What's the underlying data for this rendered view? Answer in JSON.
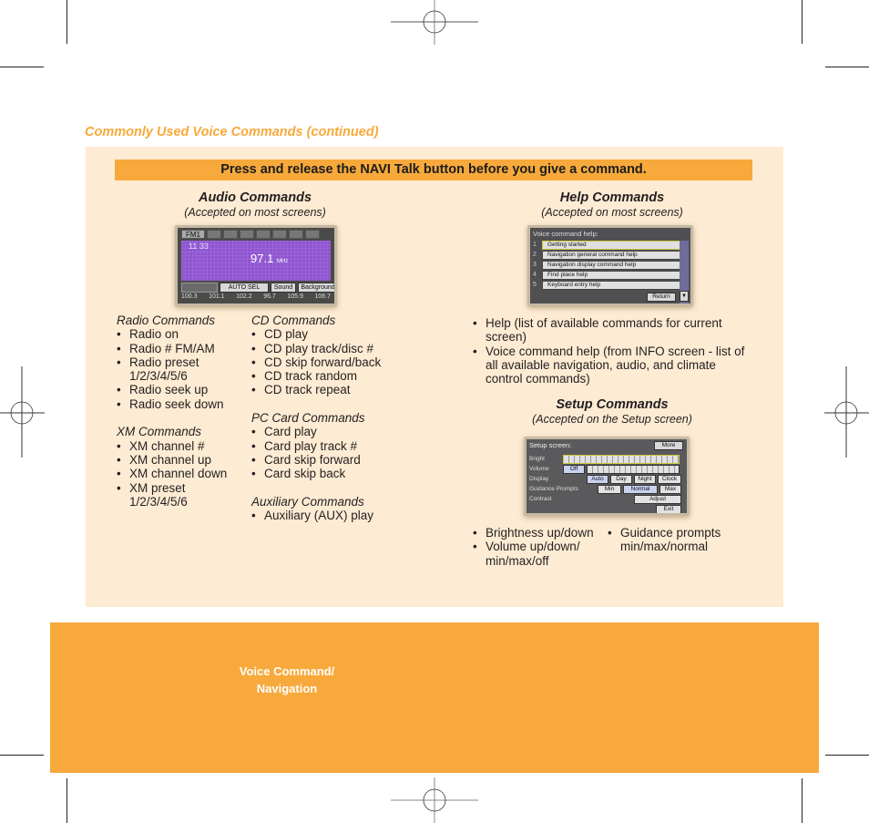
{
  "section_title": "Commonly Used Voice Commands (continued)",
  "banner": "Press and release the NAVI Talk button before you give a command.",
  "audio": {
    "heading": "Audio Commands",
    "subheading": "(Accepted on most screens)",
    "screen": {
      "band_tab": "FM1",
      "line1": "11 33",
      "frequency": "97.1",
      "frequency_unit": "MHz",
      "buttons": [
        "AUTO SEL",
        "Sound",
        "Background"
      ],
      "presets": [
        "100.3",
        "101.1",
        "102.2",
        "96.7",
        "105.9",
        "106.7"
      ]
    },
    "groups_left": [
      {
        "title": "Radio Commands",
        "items": [
          "Radio on",
          "Radio # FM/AM",
          "Radio preset 1/2/3/4/5/6",
          "Radio seek up",
          "Radio seek down"
        ]
      },
      {
        "title": "XM Commands",
        "items": [
          "XM channel #",
          "XM channel up",
          "XM channel down",
          "XM preset 1/2/3/4/5/6"
        ]
      }
    ],
    "groups_right": [
      {
        "title": "CD Commands",
        "items": [
          "CD play",
          "CD play track/disc #",
          "CD skip forward/back",
          "CD track random",
          "CD track repeat"
        ]
      },
      {
        "title": "PC Card Commands",
        "items": [
          "Card play",
          "Card play track #",
          "Card skip forward",
          "Card skip back"
        ]
      },
      {
        "title": "Auxiliary Commands",
        "items": [
          "Auxiliary (AUX) play"
        ]
      }
    ]
  },
  "help": {
    "heading": "Help Commands",
    "subheading": "(Accepted on most screens)",
    "screen": {
      "title": "Voice command help:",
      "items": [
        {
          "num": "1",
          "label": "Getting started"
        },
        {
          "num": "2",
          "label": "Navigation general command help"
        },
        {
          "num": "3",
          "label": "Navigation display command help"
        },
        {
          "num": "4",
          "label": "Find place help"
        },
        {
          "num": "5",
          "label": "Keyboard entry help"
        }
      ],
      "return_label": "Return",
      "down_arrow": "▼"
    },
    "items": [
      "Help (list of available commands for current screen)",
      "Voice command help (from INFO screen - list of all available navigation, audio, and climate control commands)"
    ]
  },
  "setup": {
    "heading": "Setup Commands",
    "subheading": "(Accepted on the Setup screen)",
    "screen": {
      "title": "Setup screen:",
      "more_label": "More",
      "rows": {
        "bright": "Bright",
        "volume": "Volume",
        "display": "Display",
        "guidance": "Guidance Prompts",
        "contrast": "Contrast"
      },
      "volume_off": "Off",
      "display_options": [
        "Auto",
        "Day",
        "Night",
        "Clock"
      ],
      "guidance_options": [
        "Min",
        "Normal",
        "Max"
      ],
      "adjust_label": "Adjust",
      "exit_label": "Exit"
    },
    "items_left": [
      "Brightness up/down",
      "Volume up/down/ min/max/off"
    ],
    "items_right": [
      "Guidance prompts min/max/normal"
    ]
  },
  "side_tab": {
    "line1": "Voice Command/",
    "line2": "Navigation"
  }
}
